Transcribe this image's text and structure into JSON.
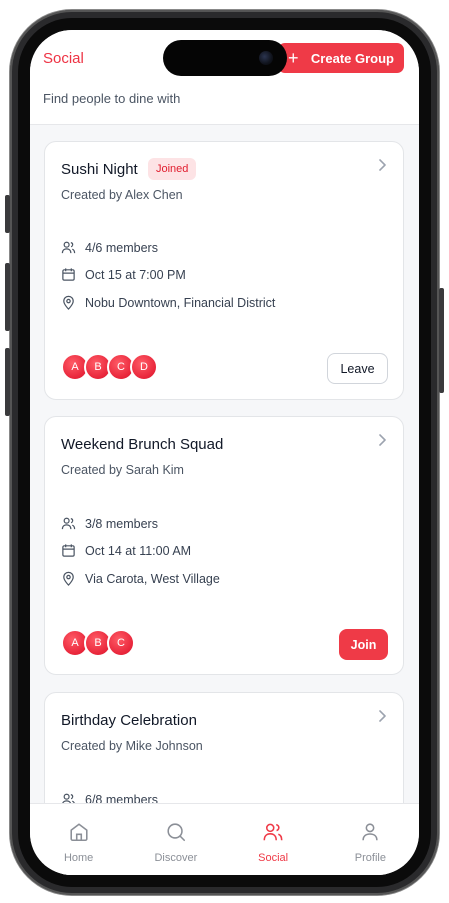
{
  "header": {
    "title": "Social",
    "create_label": "Create Group",
    "create_icon": "plus-icon",
    "subtitle": "Find people to dine with"
  },
  "groups": [
    {
      "name": "Sushi Night",
      "badge": "Joined",
      "creator": "Created by Alex Chen",
      "members": "4/6 members",
      "datetime": "Oct 15 at 7:00 PM",
      "location": "Nobu Downtown, Financial District",
      "avatars": [
        "A",
        "B",
        "C",
        "D"
      ],
      "action": "Leave"
    },
    {
      "name": "Weekend Brunch Squad",
      "creator": "Created by Sarah Kim",
      "members": "3/8 members",
      "datetime": "Oct 14 at 11:00 AM",
      "location": "Via Carota, West Village",
      "avatars": [
        "A",
        "B",
        "C"
      ],
      "action": "Join"
    },
    {
      "name": "Birthday Celebration",
      "creator": "Created by Mike Johnson",
      "members": "6/8 members"
    }
  ],
  "nav": {
    "items": [
      {
        "label": "Home",
        "icon": "home-icon"
      },
      {
        "label": "Discover",
        "icon": "search-icon"
      },
      {
        "label": "Social",
        "icon": "users-icon",
        "active": true
      },
      {
        "label": "Profile",
        "icon": "user-icon"
      }
    ]
  },
  "colors": {
    "accent": "#ef3a47",
    "badge_bg": "#fde3e5",
    "text": "#111827",
    "muted": "#4b5563"
  }
}
